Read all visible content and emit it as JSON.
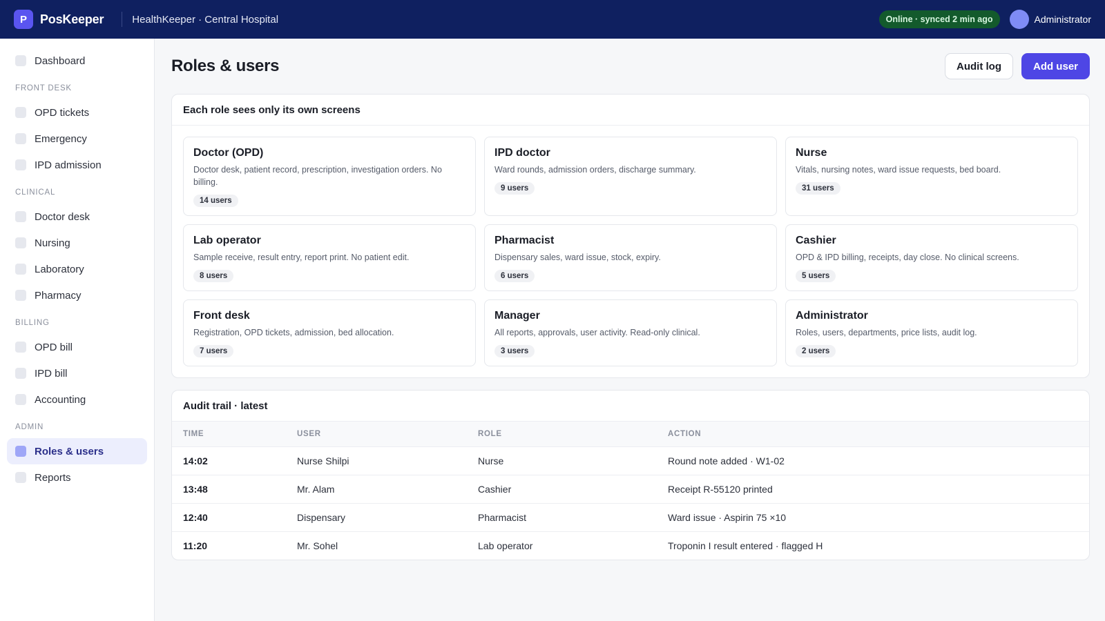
{
  "topbar": {
    "logo_letter": "P",
    "brand": "PosKeeper",
    "facility": "HealthKeeper · Central Hospital",
    "sync_status": "Online · synced 2 min ago",
    "user": "Administrator"
  },
  "sidebar": {
    "dashboard": "Dashboard",
    "sections": [
      {
        "title": "Front desk",
        "items": [
          "OPD tickets",
          "Emergency",
          "IPD admission"
        ]
      },
      {
        "title": "Clinical",
        "items": [
          "Doctor desk",
          "Nursing",
          "Laboratory",
          "Pharmacy"
        ]
      },
      {
        "title": "Billing",
        "items": [
          "OPD bill",
          "IPD bill",
          "Accounting"
        ]
      },
      {
        "title": "Admin",
        "items": [
          "Roles & users",
          "Reports"
        ]
      }
    ],
    "active_item": "Roles & users"
  },
  "page": {
    "title": "Roles & users",
    "audit_log_button": "Audit log",
    "add_user_button": "Add user"
  },
  "roles_card": {
    "title": "Each role sees only its own screens",
    "roles": [
      {
        "name": "Doctor (OPD)",
        "desc": "Doctor desk, patient record, prescription, investigation orders. No billing.",
        "count": "14 users"
      },
      {
        "name": "IPD doctor",
        "desc": "Ward rounds, admission orders, discharge summary.",
        "count": "9 users"
      },
      {
        "name": "Nurse",
        "desc": "Vitals, nursing notes, ward issue requests, bed board.",
        "count": "31 users"
      },
      {
        "name": "Lab operator",
        "desc": "Sample receive, result entry, report print. No patient edit.",
        "count": "8 users"
      },
      {
        "name": "Pharmacist",
        "desc": "Dispensary sales, ward issue, stock, expiry.",
        "count": "6 users"
      },
      {
        "name": "Cashier",
        "desc": "OPD & IPD billing, receipts, day close. No clinical screens.",
        "count": "5 users"
      },
      {
        "name": "Front desk",
        "desc": "Registration, OPD tickets, admission, bed allocation.",
        "count": "7 users"
      },
      {
        "name": "Manager",
        "desc": "All reports, approvals, user activity. Read-only clinical.",
        "count": "3 users"
      },
      {
        "name": "Administrator",
        "desc": "Roles, users, departments, price lists, audit log.",
        "count": "2 users"
      }
    ]
  },
  "audit_card": {
    "title": "Audit trail · latest",
    "columns": [
      "Time",
      "User",
      "Role",
      "Action"
    ],
    "rows": [
      {
        "time": "14:02",
        "user": "Nurse Shilpi",
        "role": "Nurse",
        "action": "Round note added · W1-02"
      },
      {
        "time": "13:48",
        "user": "Mr. Alam",
        "role": "Cashier",
        "action": "Receipt R-55120 printed"
      },
      {
        "time": "12:40",
        "user": "Dispensary",
        "role": "Pharmacist",
        "action": "Ward issue · Aspirin 75 ×10"
      },
      {
        "time": "11:20",
        "user": "Mr. Sohel",
        "role": "Lab operator",
        "action": "Troponin I result entered · flagged H"
      }
    ]
  },
  "colors": {
    "topbar": "#0f2060",
    "accent": "#4e46e5",
    "sync_badge": "#135a2c"
  }
}
